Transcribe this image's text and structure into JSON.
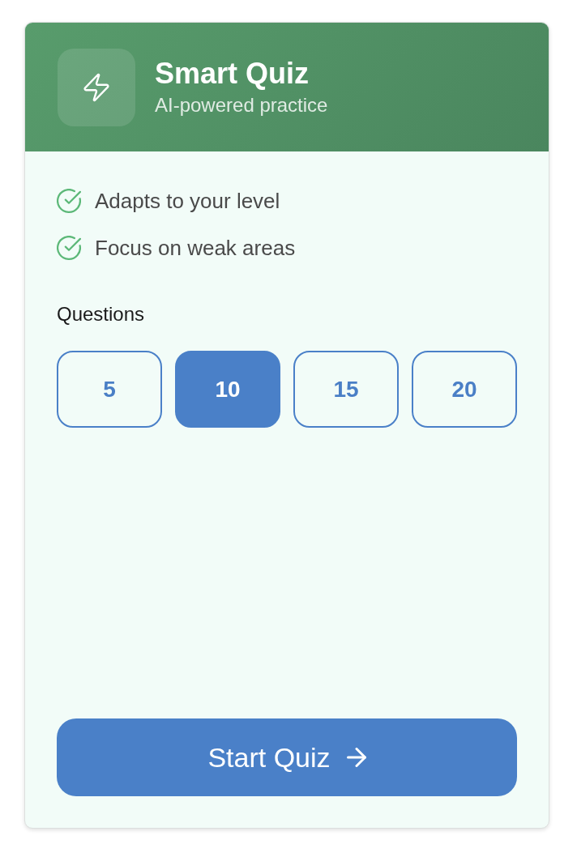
{
  "header": {
    "title": "Smart Quiz",
    "subtitle": "AI-powered practice"
  },
  "features": [
    "Adapts to your level",
    "Focus on weak areas"
  ],
  "questions": {
    "label": "Questions",
    "options": [
      {
        "label": "5",
        "selected": false
      },
      {
        "label": "10",
        "selected": true
      },
      {
        "label": "15",
        "selected": false
      },
      {
        "label": "20",
        "selected": false
      }
    ]
  },
  "start_button": {
    "label": "Start Quiz"
  }
}
